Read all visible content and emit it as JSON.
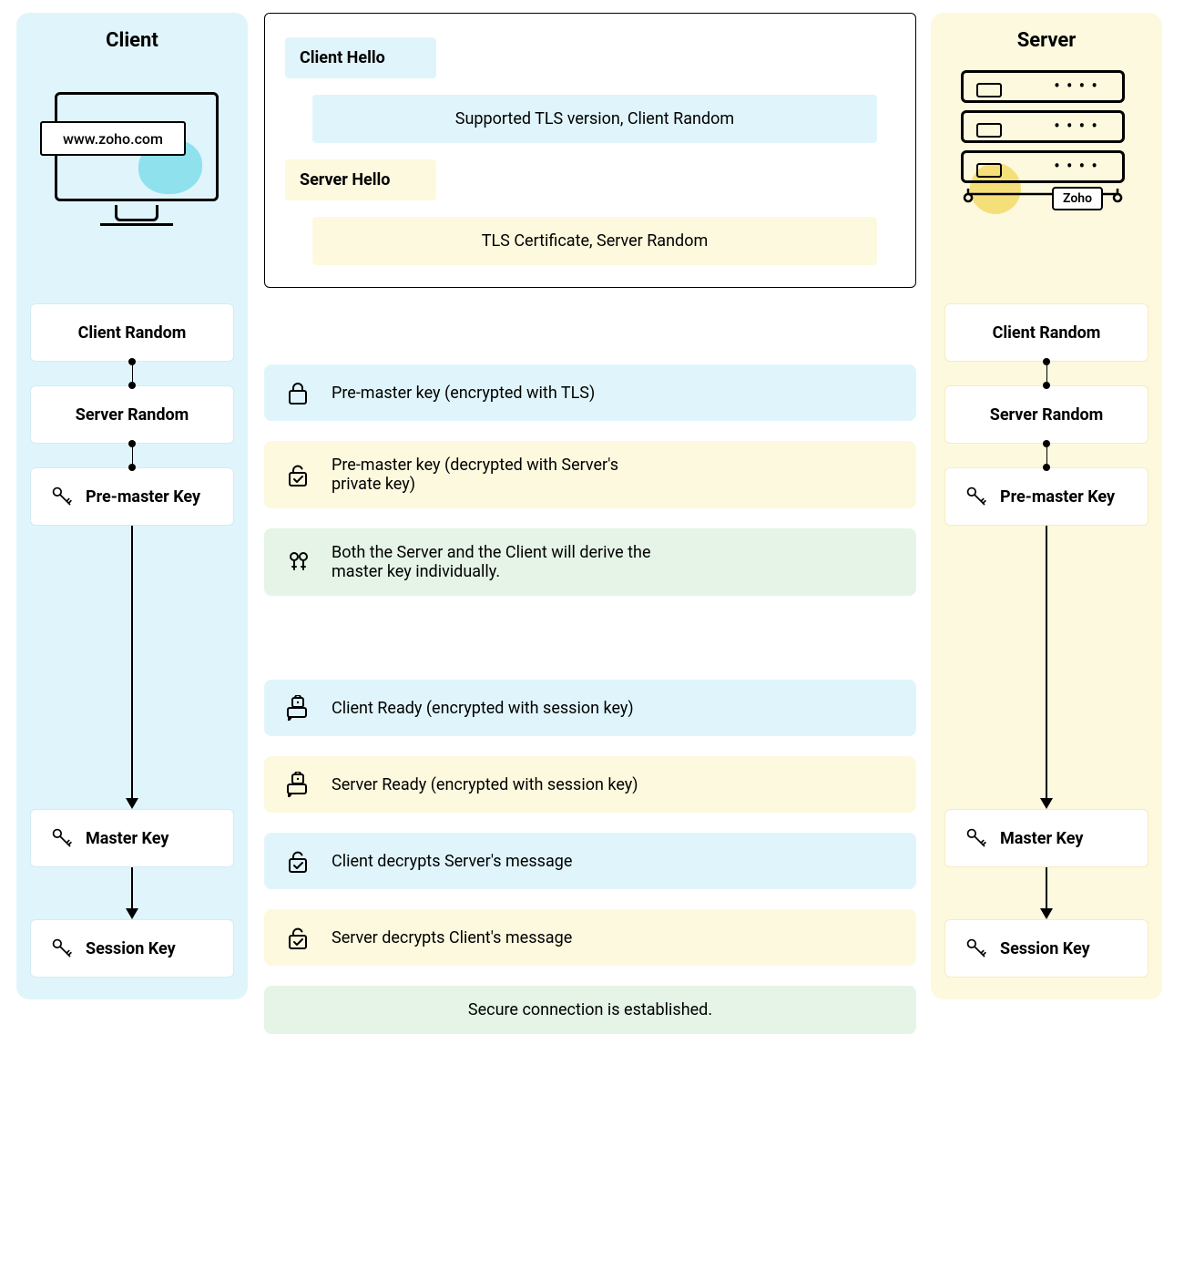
{
  "client": {
    "title": "Client",
    "url": "www.zoho.com",
    "boxes": {
      "client_random": "Client Random",
      "server_random": "Server Random",
      "premaster": "Pre-master Key",
      "master": "Master Key",
      "session": "Session Key"
    }
  },
  "server": {
    "title": "Server",
    "chip": "Zoho",
    "boxes": {
      "client_random": "Client Random",
      "server_random": "Server Random",
      "premaster": "Pre-master Key",
      "master": "Master Key",
      "session": "Session Key"
    }
  },
  "hello": {
    "client_label": "Client Hello",
    "client_bar": "Supported TLS version, Client Random",
    "server_label": "Server Hello",
    "server_bar": "TLS Certificate, Server Random"
  },
  "steps": {
    "premaster_enc": "Pre-master key (encrypted with TLS)",
    "premaster_dec": "Pre-master key (decrypted with Server's private key)",
    "derive": "Both the Server and the Client will derive the master key individually.",
    "client_ready": "Client Ready (encrypted with session key)",
    "server_ready": "Server Ready (encrypted with session key)",
    "client_decrypts": "Client decrypts Server's message",
    "server_decrypts": "Server decrypts Client's message",
    "final": "Secure connection is established."
  },
  "icons": {
    "lock": "lock-icon",
    "unlock_check": "unlock-check-icon",
    "keys_bunch": "keys-bunch-icon",
    "lock_chat": "lock-chat-icon",
    "key": "key-icon"
  }
}
